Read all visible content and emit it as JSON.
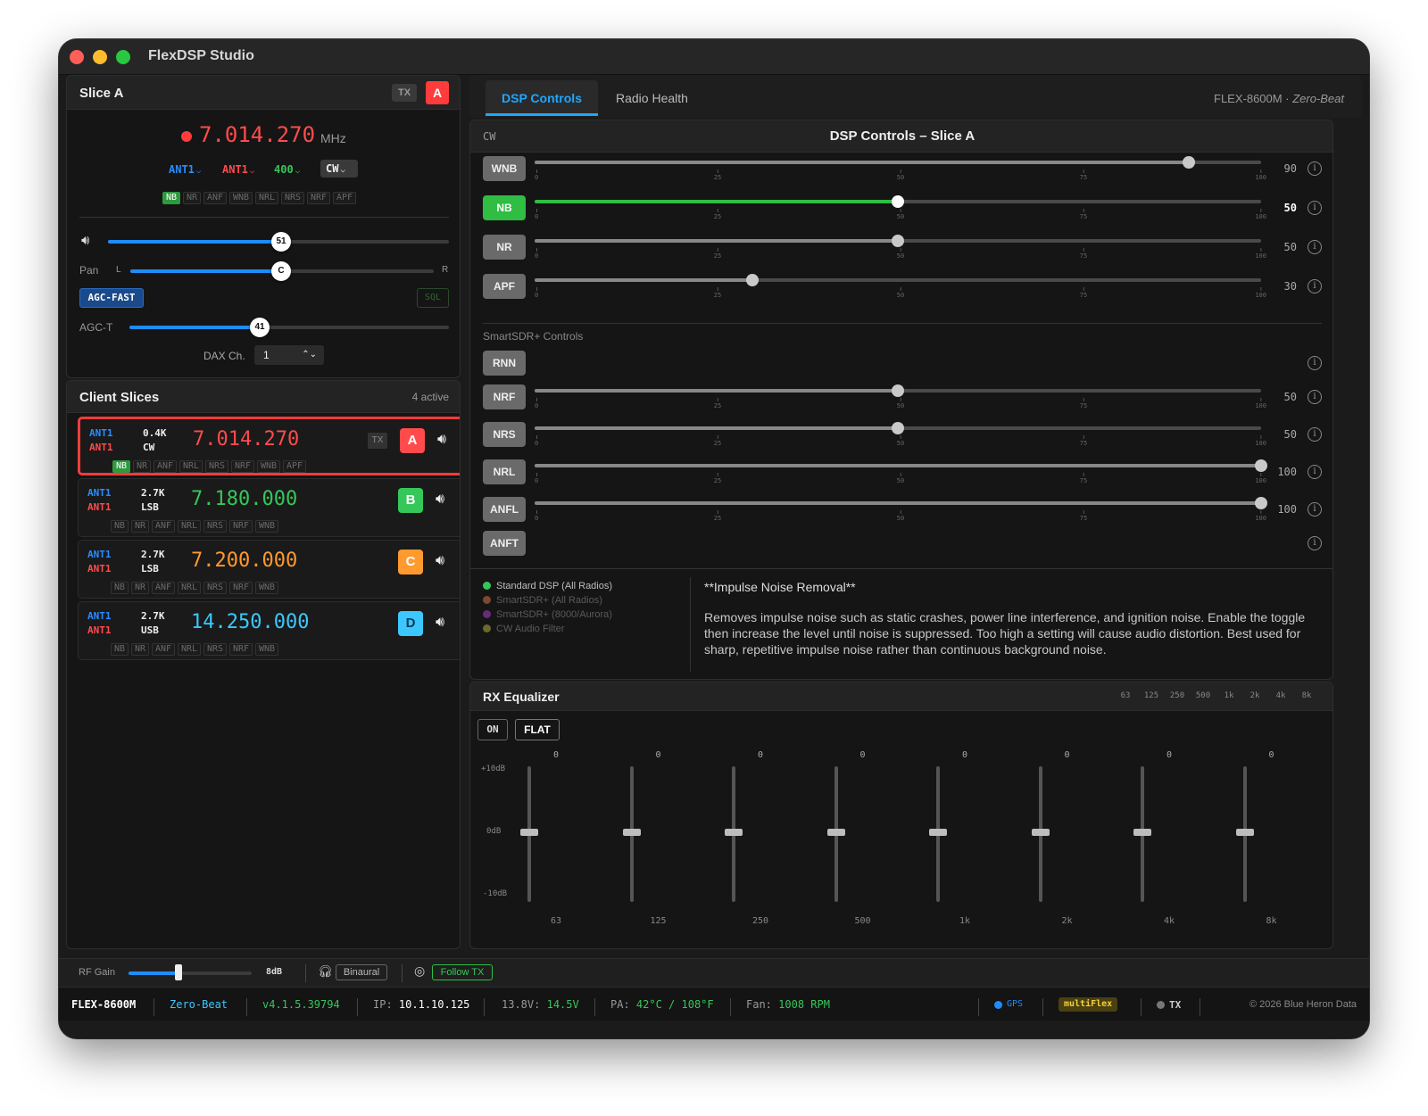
{
  "app": {
    "title": "FlexDSP Studio"
  },
  "slice_a": {
    "title": "Slice A",
    "tx_label": "TX",
    "letter": "A",
    "frequency": "7.014.270",
    "unit": "MHz",
    "ant_rx": "ANT1",
    "ant_tx": "ANT1",
    "bandwidth": "400",
    "mode": "CW",
    "dsp_chips": [
      {
        "label": "NB",
        "active": true
      },
      {
        "label": "NR",
        "active": false
      },
      {
        "label": "ANF",
        "active": false
      },
      {
        "label": "WNB",
        "active": false
      },
      {
        "label": "NRL",
        "active": false
      },
      {
        "label": "NRS",
        "active": false
      },
      {
        "label": "NRF",
        "active": false
      },
      {
        "label": "APF",
        "active": false
      }
    ],
    "volume": 51,
    "pan_label": "Pan",
    "pan_left": "L",
    "pan_right": "R",
    "pan_value": "C",
    "pan_level": 50,
    "agc_mode": "AGC-FAST",
    "sql_label": "SQL",
    "agct_label": "AGC-T",
    "agct_value": 41,
    "dax_label": "DAX Ch.",
    "dax_value": "1"
  },
  "client_slices": {
    "title": "Client Slices",
    "count_text": "4 active",
    "items": [
      {
        "ant_rx": "ANT1",
        "ant_tx": "ANT1",
        "bw": "0.4K",
        "mode": "CW",
        "freq": "7.014.270",
        "letter": "A",
        "tx": "TX",
        "color": "#ff4b4b",
        "chips": [
          {
            "label": "NB",
            "active": true
          },
          {
            "label": "NR"
          },
          {
            "label": "ANF"
          },
          {
            "label": "NRL"
          },
          {
            "label": "NRS"
          },
          {
            "label": "NRF"
          },
          {
            "label": "WNB"
          },
          {
            "label": "APF"
          }
        ]
      },
      {
        "ant_rx": "ANT1",
        "ant_tx": "ANT1",
        "bw": "2.7K",
        "mode": "LSB",
        "freq": "7.180.000",
        "letter": "B",
        "color": "#35c759",
        "chips": [
          {
            "label": "NB"
          },
          {
            "label": "NR"
          },
          {
            "label": "ANF"
          },
          {
            "label": "NRL"
          },
          {
            "label": "NRS"
          },
          {
            "label": "NRF"
          },
          {
            "label": "WNB"
          }
        ]
      },
      {
        "ant_rx": "ANT1",
        "ant_tx": "ANT1",
        "bw": "2.7K",
        "mode": "LSB",
        "freq": "7.200.000",
        "letter": "C",
        "color": "#ff9a2e",
        "chips": [
          {
            "label": "NB"
          },
          {
            "label": "NR"
          },
          {
            "label": "ANF"
          },
          {
            "label": "NRL"
          },
          {
            "label": "NRS"
          },
          {
            "label": "NRF"
          },
          {
            "label": "WNB"
          }
        ]
      },
      {
        "ant_rx": "ANT1",
        "ant_tx": "ANT1",
        "bw": "2.7K",
        "mode": "USB",
        "freq": "14.250.000",
        "letter": "D",
        "color": "#3cc8ff",
        "chips": [
          {
            "label": "NB"
          },
          {
            "label": "NR"
          },
          {
            "label": "ANF"
          },
          {
            "label": "NRL"
          },
          {
            "label": "NRS"
          },
          {
            "label": "NRF"
          },
          {
            "label": "WNB"
          }
        ]
      }
    ]
  },
  "tabs": {
    "active": "DSP Controls",
    "other": "Radio Health",
    "radio": "FLEX-8600M",
    "dot": "·",
    "mode": "Zero-Beat"
  },
  "dsp": {
    "mode_tag": "CW",
    "title": "DSP Controls – Slice A",
    "tick_labels": [
      "0",
      "25",
      "50",
      "75",
      "100"
    ],
    "controls": [
      {
        "label": "WNB",
        "value": 90,
        "active": false,
        "has_slider": true
      },
      {
        "label": "NB",
        "value": 50,
        "active": true,
        "has_slider": true
      },
      {
        "label": "NR",
        "value": 50,
        "active": false,
        "has_slider": true
      },
      {
        "label": "APF",
        "value": 30,
        "active": false,
        "has_slider": true
      }
    ],
    "smartsdr_title": "SmartSDR+ Controls",
    "smartsdr_controls": [
      {
        "label": "RNN",
        "has_slider": false
      },
      {
        "label": "NRF",
        "value": 50,
        "has_slider": true
      },
      {
        "label": "NRS",
        "value": 50,
        "has_slider": true
      },
      {
        "label": "NRL",
        "value": 100,
        "has_slider": true
      },
      {
        "label": "ANFL",
        "value": 100,
        "has_slider": true
      },
      {
        "label": "ANFT",
        "has_slider": false
      }
    ],
    "legend": [
      {
        "label": "Standard DSP (All Radios)",
        "color": "#35c759",
        "text_color": "#bdbdbd"
      },
      {
        "label": "SmartSDR+ (All Radios)",
        "color": "#7a4a2e",
        "text_color": "#5a5a5a"
      },
      {
        "label": "SmartSDR+ (8000/Aurora)",
        "color": "#6a2a7a",
        "text_color": "#5a5a5a"
      },
      {
        "label": "CW Audio Filter",
        "color": "#6a6a2a",
        "text_color": "#5a5a5a"
      }
    ],
    "help_title": "**Impulse Noise Removal**",
    "help_text": "Removes impulse noise such as static crashes, power line interference, and ignition noise. Enable the toggle then increase the level until noise is suppressed. Too high a setting will cause audio distortion. Best used for sharp, repetitive impulse noise rather than continuous background noise."
  },
  "eq": {
    "title": "RX Equalizer",
    "header_bands": [
      "63",
      "125",
      "250",
      "500",
      "1k",
      "2k",
      "4k",
      "8k"
    ],
    "on_label": "ON",
    "flat_label": "FLAT",
    "scale": {
      "top": "+10dB",
      "mid": "0dB",
      "bottom": "-10dB"
    },
    "bands": [
      {
        "label": "63",
        "value": 0
      },
      {
        "label": "125",
        "value": 0
      },
      {
        "label": "250",
        "value": 0
      },
      {
        "label": "500",
        "value": 0
      },
      {
        "label": "1k",
        "value": 0
      },
      {
        "label": "2k",
        "value": 0
      },
      {
        "label": "4k",
        "value": 0
      },
      {
        "label": "8k",
        "value": 0
      }
    ]
  },
  "rf_bar": {
    "label": "RF Gain",
    "value": "8dB",
    "level": 40,
    "binaural": "Binaural",
    "follow_tx": "Follow TX"
  },
  "status": {
    "radio": "FLEX-8600M",
    "mode": "Zero-Beat",
    "version": "v4.1.5.39794",
    "ip_label": "IP:",
    "ip": "10.1.10.125",
    "volt_label": "13.8V:",
    "volt": "14.5V",
    "pa_label": "PA:",
    "pa": "42°C / 108°F",
    "fan_label": "Fan:",
    "fan": "1008 RPM",
    "gps": "GPS",
    "multiflex": "multiFlex",
    "tx": "TX",
    "copyright": "© 2026 Blue Heron Data"
  }
}
